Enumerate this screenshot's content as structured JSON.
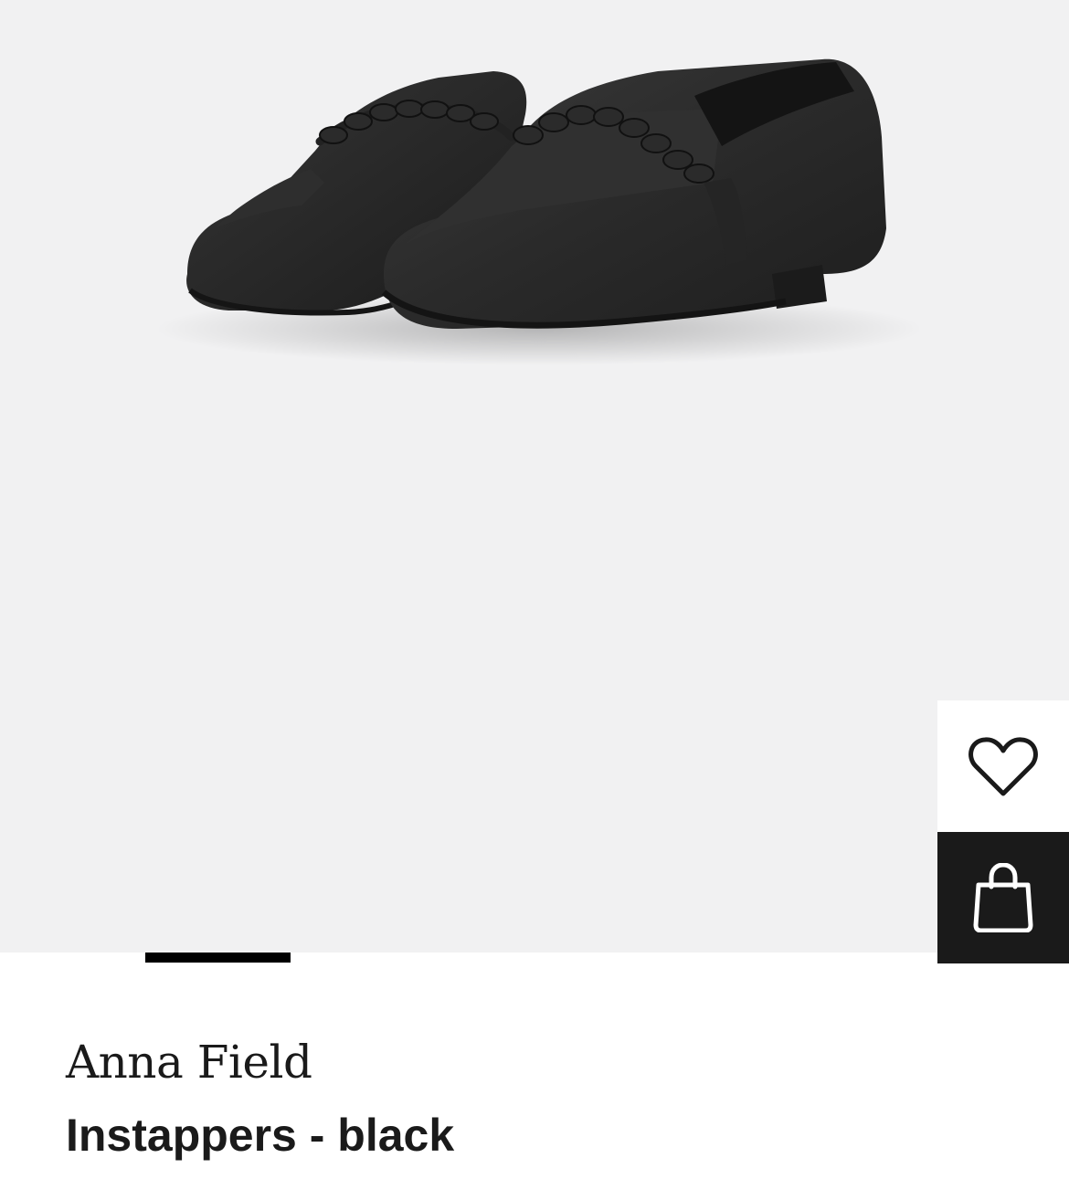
{
  "product": {
    "brand": "Anna Field",
    "title": "Instappers - black"
  },
  "gallery": {
    "image_subject": "pair-of-black-loafers",
    "background_color": "#f1f1f2",
    "pager": {
      "active_index": 1,
      "segment_count": 6
    }
  },
  "actions": {
    "wishlist_icon": "heart-outline-icon",
    "bag_icon": "shopping-bag-icon",
    "bag_background": "#1a1a1a"
  }
}
